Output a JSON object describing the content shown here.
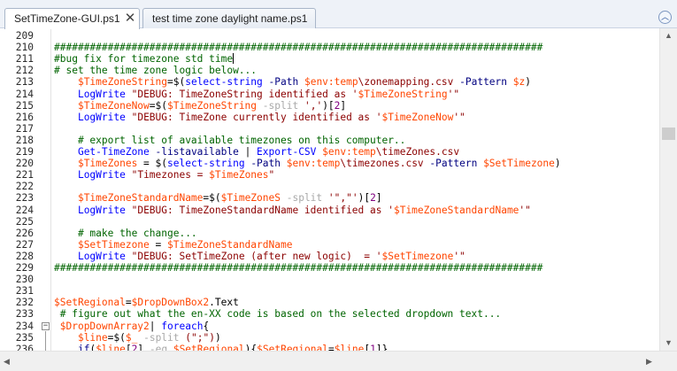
{
  "tabs": [
    {
      "label": "SetTimeZone-GUI.ps1",
      "close": "✕",
      "active": true
    },
    {
      "label": "test time zone daylight name.ps1",
      "active": false
    }
  ],
  "collapse_icon": "chevron-up-icon",
  "editor": {
    "lines": [
      {
        "num": "209",
        "segs": [
          [
            "",
            "plain"
          ]
        ]
      },
      {
        "num": "210",
        "segs": [
          [
            "##################################################################################",
            "comment"
          ]
        ]
      },
      {
        "num": "211",
        "segs": [
          [
            "#bug fix for timezone std time",
            "comment"
          ]
        ],
        "cursor": true
      },
      {
        "num": "212",
        "segs": [
          [
            "# set the time zone logic below...",
            "comment"
          ]
        ]
      },
      {
        "num": "213",
        "segs": [
          [
            "    ",
            "plain"
          ],
          [
            "$TimeZoneString",
            "var"
          ],
          [
            "=$(",
            "plain"
          ],
          [
            "select-string",
            "cmd"
          ],
          [
            " ",
            "plain"
          ],
          [
            "-Path",
            "param"
          ],
          [
            " ",
            "plain"
          ],
          [
            "$env:temp",
            "var"
          ],
          [
            "\\zonemapping.csv",
            "str"
          ],
          [
            " ",
            "plain"
          ],
          [
            "-Pattern",
            "param"
          ],
          [
            " ",
            "plain"
          ],
          [
            "$z",
            "var"
          ],
          [
            ")",
            "plain"
          ]
        ]
      },
      {
        "num": "214",
        "segs": [
          [
            "    ",
            "plain"
          ],
          [
            "LogWrite",
            "cmd"
          ],
          [
            " ",
            "plain"
          ],
          [
            "\"DEBUG: TimeZoneString identified as '",
            "str"
          ],
          [
            "$TimeZoneString",
            "var"
          ],
          [
            "'\"",
            "str"
          ]
        ]
      },
      {
        "num": "215",
        "segs": [
          [
            "    ",
            "plain"
          ],
          [
            "$TimeZoneNow",
            "var"
          ],
          [
            "=$(",
            "plain"
          ],
          [
            "$TimeZoneString",
            "var"
          ],
          [
            " ",
            "plain"
          ],
          [
            "-split",
            "op"
          ],
          [
            " ",
            "plain"
          ],
          [
            "','",
            "str"
          ],
          [
            ")[",
            "plain"
          ],
          [
            "2",
            "num"
          ],
          [
            "]",
            "plain"
          ]
        ]
      },
      {
        "num": "216",
        "segs": [
          [
            "    ",
            "plain"
          ],
          [
            "LogWrite",
            "cmd"
          ],
          [
            " ",
            "plain"
          ],
          [
            "\"DEBUG: TimeZone currently identified as '",
            "str"
          ],
          [
            "$TimeZoneNow",
            "var"
          ],
          [
            "'\"",
            "str"
          ]
        ]
      },
      {
        "num": "217",
        "segs": [
          [
            "",
            "plain"
          ]
        ]
      },
      {
        "num": "218",
        "segs": [
          [
            "    ",
            "plain"
          ],
          [
            "# export list of available timezones on this computer..",
            "comment"
          ]
        ]
      },
      {
        "num": "219",
        "segs": [
          [
            "    ",
            "plain"
          ],
          [
            "Get-TimeZone",
            "cmd"
          ],
          [
            " ",
            "plain"
          ],
          [
            "-listavailable",
            "param"
          ],
          [
            " | ",
            "plain"
          ],
          [
            "Export-CSV",
            "cmd"
          ],
          [
            " ",
            "plain"
          ],
          [
            "$env:temp",
            "var"
          ],
          [
            "\\timeZones.csv",
            "str"
          ]
        ]
      },
      {
        "num": "220",
        "segs": [
          [
            "    ",
            "plain"
          ],
          [
            "$TimeZones",
            "var"
          ],
          [
            " = $(",
            "plain"
          ],
          [
            "select-string",
            "cmd"
          ],
          [
            " ",
            "plain"
          ],
          [
            "-Path",
            "param"
          ],
          [
            " ",
            "plain"
          ],
          [
            "$env:temp",
            "var"
          ],
          [
            "\\timezones.csv",
            "str"
          ],
          [
            " ",
            "plain"
          ],
          [
            "-Pattern",
            "param"
          ],
          [
            " ",
            "plain"
          ],
          [
            "$SetTimezone",
            "var"
          ],
          [
            ")",
            "plain"
          ]
        ]
      },
      {
        "num": "221",
        "segs": [
          [
            "    ",
            "plain"
          ],
          [
            "LogWrite",
            "cmd"
          ],
          [
            " ",
            "plain"
          ],
          [
            "\"Timezones = ",
            "str"
          ],
          [
            "$TimeZones",
            "var"
          ],
          [
            "\"",
            "str"
          ]
        ]
      },
      {
        "num": "222",
        "segs": [
          [
            "",
            "plain"
          ]
        ]
      },
      {
        "num": "223",
        "segs": [
          [
            "    ",
            "plain"
          ],
          [
            "$TimeZoneStandardName",
            "var"
          ],
          [
            "=$(",
            "plain"
          ],
          [
            "$TimeZoneS",
            "var"
          ],
          [
            " ",
            "plain"
          ],
          [
            "-split",
            "op"
          ],
          [
            " ",
            "plain"
          ],
          [
            "'\",\"'",
            "str"
          ],
          [
            ")[",
            "plain"
          ],
          [
            "2",
            "num"
          ],
          [
            "]",
            "plain"
          ]
        ]
      },
      {
        "num": "224",
        "segs": [
          [
            "    ",
            "plain"
          ],
          [
            "LogWrite",
            "cmd"
          ],
          [
            " ",
            "plain"
          ],
          [
            "\"DEBUG: TimeZoneStandardName identified as '",
            "str"
          ],
          [
            "$TimeZoneStandardName",
            "var"
          ],
          [
            "'\"",
            "str"
          ]
        ]
      },
      {
        "num": "225",
        "segs": [
          [
            "",
            "plain"
          ]
        ]
      },
      {
        "num": "226",
        "segs": [
          [
            "    ",
            "plain"
          ],
          [
            "# make the change...",
            "comment"
          ]
        ]
      },
      {
        "num": "227",
        "segs": [
          [
            "    ",
            "plain"
          ],
          [
            "$SetTimezone",
            "var"
          ],
          [
            " = ",
            "plain"
          ],
          [
            "$TimeZoneStandardName",
            "var"
          ]
        ]
      },
      {
        "num": "228",
        "segs": [
          [
            "    ",
            "plain"
          ],
          [
            "LogWrite",
            "cmd"
          ],
          [
            " ",
            "plain"
          ],
          [
            "\"DEBUG: SetTimeZone (after new logic)  = '",
            "str"
          ],
          [
            "$SetTimezone",
            "var"
          ],
          [
            "'\"",
            "str"
          ]
        ]
      },
      {
        "num": "229",
        "segs": [
          [
            "##################################################################################",
            "comment"
          ]
        ]
      },
      {
        "num": "230",
        "segs": [
          [
            "",
            "plain"
          ]
        ]
      },
      {
        "num": "231",
        "segs": [
          [
            "",
            "plain"
          ]
        ]
      },
      {
        "num": "232",
        "segs": [
          [
            "$SetRegional",
            "var"
          ],
          [
            "=",
            "plain"
          ],
          [
            "$DropDownBox2",
            "var"
          ],
          [
            ".",
            "plain"
          ],
          [
            "Text",
            "prop"
          ]
        ]
      },
      {
        "num": "233",
        "segs": [
          [
            " ",
            "plain"
          ],
          [
            "# figure out what the en-XX code is based on the selected dropdown text...",
            "comment"
          ]
        ]
      },
      {
        "num": "234",
        "segs": [
          [
            " ",
            "plain"
          ],
          [
            "$DropDownArray2",
            "var"
          ],
          [
            "| ",
            "plain"
          ],
          [
            "foreach",
            "cmd"
          ],
          [
            "{",
            "plain"
          ]
        ],
        "fold": true
      },
      {
        "num": "235",
        "segs": [
          [
            "    ",
            "plain"
          ],
          [
            "$line",
            "var"
          ],
          [
            "=$(",
            "plain"
          ],
          [
            "$_",
            "var"
          ],
          [
            " ",
            "plain"
          ],
          [
            "-split",
            "op"
          ],
          [
            " ",
            "plain"
          ],
          [
            "(\";\")",
            "str"
          ],
          [
            ")",
            "plain"
          ]
        ]
      },
      {
        "num": "236",
        "segs": [
          [
            "    ",
            "plain"
          ],
          [
            "if",
            "key"
          ],
          [
            "(",
            "plain"
          ],
          [
            "$line",
            "var"
          ],
          [
            "[",
            "plain"
          ],
          [
            "2",
            "num"
          ],
          [
            "] ",
            "plain"
          ],
          [
            "-eq",
            "op"
          ],
          [
            " ",
            "plain"
          ],
          [
            "$SetRegional",
            "var"
          ],
          [
            "){",
            "plain"
          ],
          [
            "$SetRegional",
            "var"
          ],
          [
            "=",
            "plain"
          ],
          [
            "$line",
            "var"
          ],
          [
            "[",
            "plain"
          ],
          [
            "1",
            "num"
          ],
          [
            "]}",
            "plain"
          ]
        ]
      }
    ]
  },
  "scrollbar_icons": {
    "up": "triangle-up-icon",
    "down": "triangle-down-icon",
    "left": "triangle-left-icon",
    "right": "triangle-right-icon"
  }
}
